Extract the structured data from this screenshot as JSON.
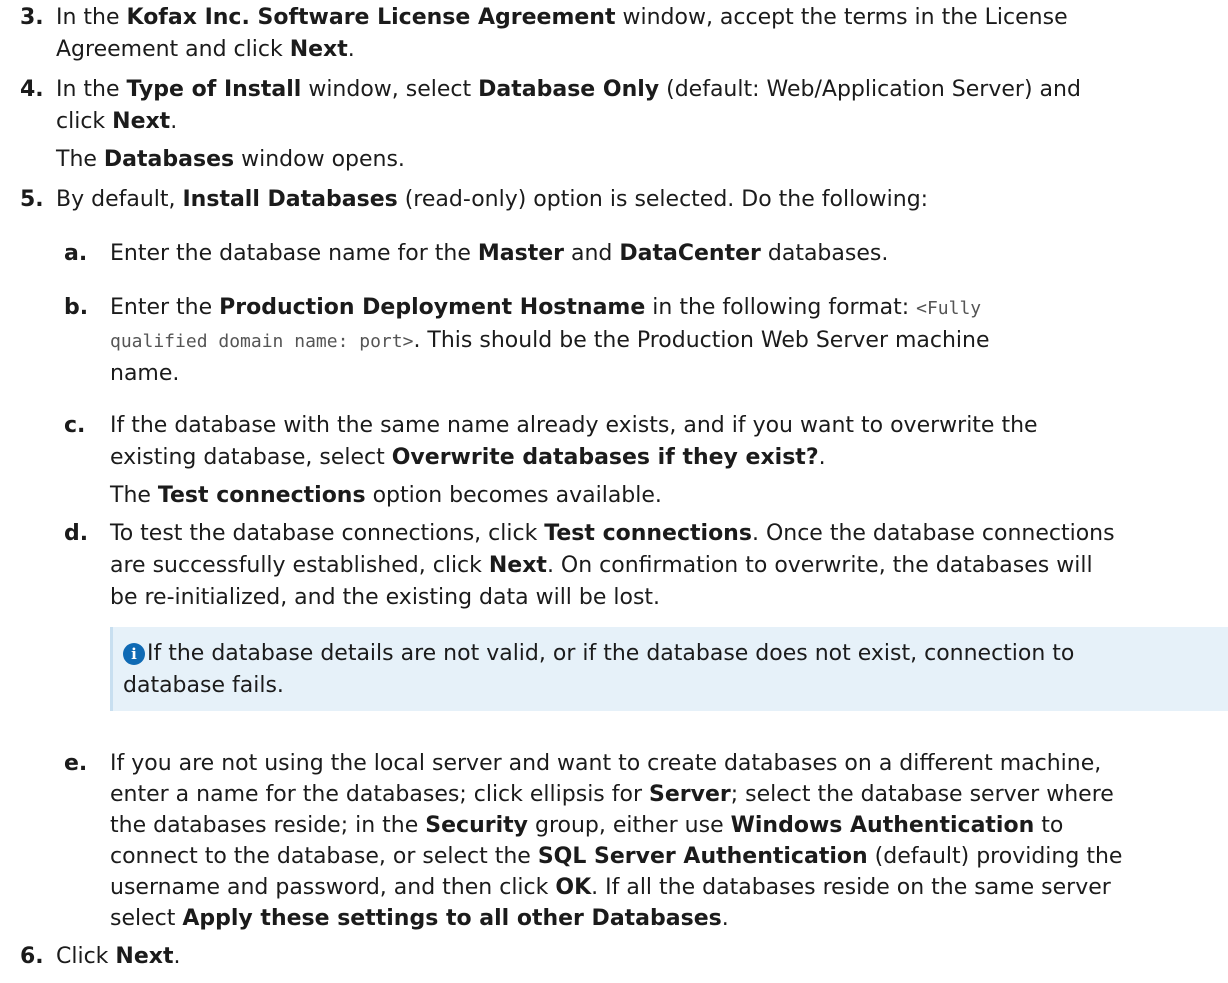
{
  "steps": {
    "s3": {
      "num": "3.",
      "l1a": "In the ",
      "l1b": "Kofax Inc. Software License Agreement",
      "l1c": " window, accept the terms in the License",
      "l2a": "Agreement and click ",
      "l2b": "Next",
      "l2c": "."
    },
    "s4": {
      "num": "4.",
      "l1a": "In the ",
      "l1b": "Type of Install",
      "l1c": " window, select ",
      "l1d": "Database Only",
      "l1e": " (default: Web/Application Server) and",
      "l2a": "click ",
      "l2b": "Next",
      "l2c": ".",
      "c1a": "The ",
      "c1b": "Databases",
      "c1c": " window opens."
    },
    "s5": {
      "num": "5.",
      "l1a": "By default, ",
      "l1b": "Install Databases",
      "l1c": " (read-only) option is selected. Do the following:",
      "a": {
        "letter": "a.",
        "l1a": "Enter the database name for the ",
        "l1b": "Master",
        "l1c": " and ",
        "l1d": "DataCenter",
        "l1e": " databases."
      },
      "b": {
        "letter": "b.",
        "l1a": "Enter the ",
        "l1b": "Production Deployment Hostname",
        "l1c": " in the following format: ",
        "l1d": "<Fully",
        "l2a": "qualified domain name: port>",
        "l2b": ". This should be the Production Web Server machine",
        "l3a": "name."
      },
      "c": {
        "letter": "c.",
        "l1a": "If the database with the same name already exists, and if you want to overwrite the",
        "l2a": "existing database, select ",
        "l2b": "Overwrite databases if they exist?",
        "l2c": ".",
        "c1a": "The ",
        "c1b": "Test connections",
        "c1c": " option becomes available."
      },
      "d": {
        "letter": "d.",
        "l1a": "To test the database connections, click ",
        "l1b": "Test connections",
        "l1c": ". Once the database connections",
        "l2a": "are successfully established, click ",
        "l2b": "Next",
        "l2c": ". On confirmation to overwrite, the databases will",
        "l3a": "be re-initialized, and the existing data will be lost."
      },
      "note": {
        "icon": "info-icon",
        "l1": " If the database details are not valid, or if the database does not exist, connection to",
        "l2": "database fails."
      },
      "e": {
        "letter": "e.",
        "l1a": "If you are not using the local server and want to create databases on a different machine,",
        "l2a": "enter a name for the databases; click ellipsis for ",
        "l2b": "Server",
        "l2c": "; select the database server where",
        "l3a": "the databases reside; in the ",
        "l3b": "Security",
        "l3c": " group, either use ",
        "l3d": "Windows Authentication",
        "l3e": " to",
        "l4a": "connect to the database, or select the ",
        "l4b": "SQL Server Authentication",
        "l4c": " (default) providing the",
        "l5a": "username and password, and then click ",
        "l5b": "OK",
        "l5c": ". If all the databases reside on the same server",
        "l6a": "select ",
        "l6b": "Apply these settings to all other Databases",
        "l6c": "."
      }
    },
    "s6": {
      "num": "6.",
      "l1a": "Click ",
      "l1b": "Next",
      "l1c": "."
    }
  }
}
